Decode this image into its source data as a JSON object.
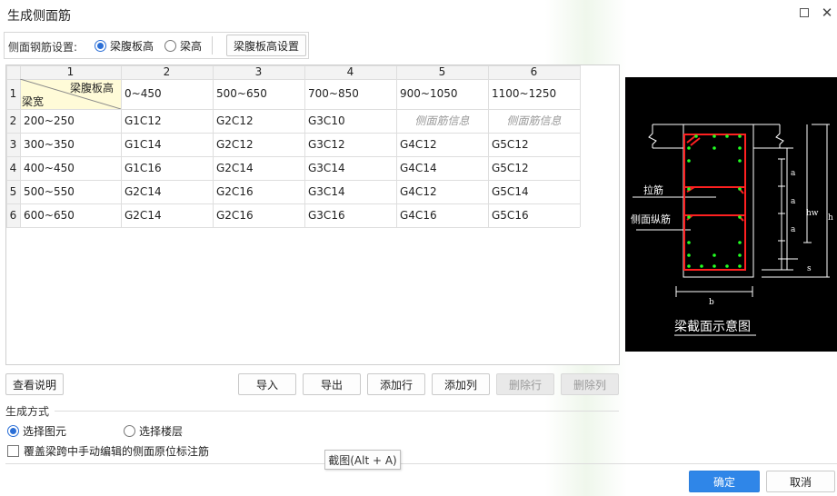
{
  "window": {
    "title": "生成侧面筋"
  },
  "settings": {
    "label": "侧面钢筋设置:",
    "options": [
      {
        "label": "梁腹板高",
        "selected": true
      },
      {
        "label": "梁高",
        "selected": false
      }
    ],
    "config_button": "梁腹板高设置"
  },
  "table": {
    "column_headers": [
      "1",
      "2",
      "3",
      "4",
      "5",
      "6"
    ],
    "row_headers": [
      "1",
      "2",
      "3",
      "4",
      "5",
      "6"
    ],
    "corner_top": "梁腹板高",
    "corner_bottom": "梁宽",
    "web_heights": [
      "0~450",
      "500~650",
      "700~850",
      "900~1050",
      "1100~1250"
    ],
    "rows": [
      {
        "width": "200~250",
        "cells": [
          "G1C12",
          "G2C12",
          "G3C10",
          "侧面筋信息",
          "侧面筋信息"
        ]
      },
      {
        "width": "300~350",
        "cells": [
          "G1C14",
          "G2C12",
          "G3C12",
          "G4C12",
          "G5C12"
        ]
      },
      {
        "width": "400~450",
        "cells": [
          "G1C16",
          "G2C14",
          "G3C14",
          "G4C14",
          "G5C12"
        ]
      },
      {
        "width": "500~550",
        "cells": [
          "G2C14",
          "G2C16",
          "G3C14",
          "G4C12",
          "G5C14"
        ]
      },
      {
        "width": "600~650",
        "cells": [
          "G2C14",
          "G2C16",
          "G3C16",
          "G4C16",
          "G5C16"
        ]
      }
    ],
    "placeholder": "侧面筋信息"
  },
  "diagram": {
    "caption": "梁截面示意图",
    "tie_label": "拉筋",
    "side_bar_label": "侧面纵筋",
    "dim_a": "a",
    "dim_hw": "hw",
    "dim_h": "h",
    "dim_s": "s",
    "dim_b": "b",
    "colors": {
      "bg": "#000000",
      "stirrup": "#ff2020",
      "bar": "#22ff22",
      "line": "#ffffff"
    }
  },
  "toolbar": {
    "help": "查看说明",
    "import": "导入",
    "export": "导出",
    "add_row": "添加行",
    "add_col": "添加列",
    "del_row": "删除行",
    "del_col": "删除列"
  },
  "generation": {
    "title": "生成方式",
    "options": [
      {
        "label": "选择图元",
        "selected": true
      },
      {
        "label": "选择楼层",
        "selected": false
      }
    ],
    "override_checkbox": "覆盖梁跨中手动编辑的侧面原位标注筋",
    "override_checked": false
  },
  "tooltip": "截图(Alt + A)",
  "footer": {
    "ok": "确定",
    "cancel": "取消"
  }
}
